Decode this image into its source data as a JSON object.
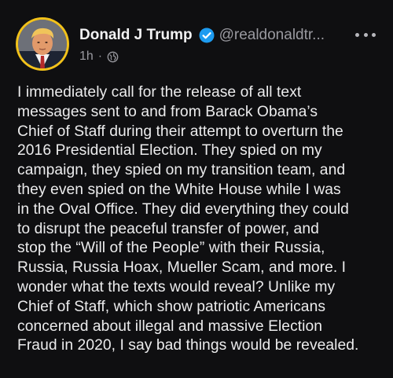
{
  "post": {
    "author": {
      "display_name": "Donald J Trump",
      "handle": "@realdonaldtr...",
      "verified_icon": "verified-check-icon",
      "avatar_ring_color": "#f2c21a"
    },
    "meta": {
      "time": "1h",
      "separator": "·",
      "visibility_icon": "globe-icon"
    },
    "more_icon": "more-options-icon",
    "body_lines": [
      "I immediately call for the release of all text",
      "messages sent to and from Barack Obama’s",
      "Chief of Staff during their attempt to overturn the",
      "2016 Presidential Election. They spied on my",
      "campaign, they spied on my transition team, and",
      "they even spied on the White House while I was",
      "in the Oval Office. They did everything they could",
      "to disrupt the peaceful transfer of power, and",
      "stop the “Will of the People” with their Russia,",
      "Russia, Russia Hoax, Mueller Scam, and more. I",
      "wonder what the texts would reveal? Unlike my",
      "Chief of Staff, which show patriotic Americans",
      "concerned about illegal and massive Election",
      "Fraud in 2020, I say bad things would be revealed."
    ]
  },
  "colors": {
    "background": "#0f0f11",
    "text": "#ececed",
    "muted": "#9a9aa0",
    "verified": "#1d9bf0"
  }
}
